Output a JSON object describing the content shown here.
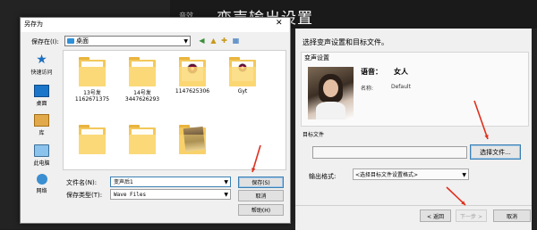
{
  "app": {
    "side_label": "音效",
    "page_title": "变声输出设置",
    "instruction": "选择变声设置和目标文件。",
    "voice_group": {
      "label": "变声设置",
      "voice_key": "语音：",
      "voice_value": "女人",
      "name_key": "名称:",
      "name_value": "Default"
    },
    "target_group": {
      "label": "目标文件",
      "path_value": "",
      "choose_button": "选择文件..."
    },
    "format": {
      "label": "输出格式:",
      "selected": "<选择目标文件设置格式>"
    },
    "wizard_buttons": {
      "back": "< 返回",
      "next": "下一步 >",
      "cancel": "取消"
    }
  },
  "dialog": {
    "title": "另存为",
    "close_glyph": "✕",
    "save_in_label": "保存在(I):",
    "save_in_value": "桌面",
    "places": [
      {
        "label": "快速访问",
        "icon": "star-icon"
      },
      {
        "label": "桌面",
        "icon": "desktop-icon"
      },
      {
        "label": "库",
        "icon": "library-icon"
      },
      {
        "label": "此电脑",
        "icon": "computer-icon"
      },
      {
        "label": "网络",
        "icon": "network-icon"
      }
    ],
    "files": [
      {
        "line1": "13号发",
        "line2": "1162671375",
        "kind": "folder"
      },
      {
        "line1": "14号发",
        "line2": "3447626293",
        "kind": "folder"
      },
      {
        "line1": "1147625306",
        "line2": "",
        "kind": "folder-media"
      },
      {
        "line1": "Gyt",
        "line2": "",
        "kind": "folder"
      },
      {
        "line1": "",
        "line2": "",
        "kind": "folder"
      },
      {
        "line1": "",
        "line2": "",
        "kind": "folder"
      },
      {
        "line1": "",
        "line2": "",
        "kind": "folder-photo"
      }
    ],
    "filename_label": "文件名(N):",
    "filename_value": "变声后1",
    "filetype_label": "保存类型(T):",
    "filetype_value": "Wave Files",
    "buttons": {
      "save": "保存(S)",
      "cancel": "取消",
      "help": "帮助(H)"
    }
  },
  "colors": {
    "arrow": "#e0301e",
    "dark_bg": "#232323",
    "accent_blue": "#3c7fb1"
  }
}
